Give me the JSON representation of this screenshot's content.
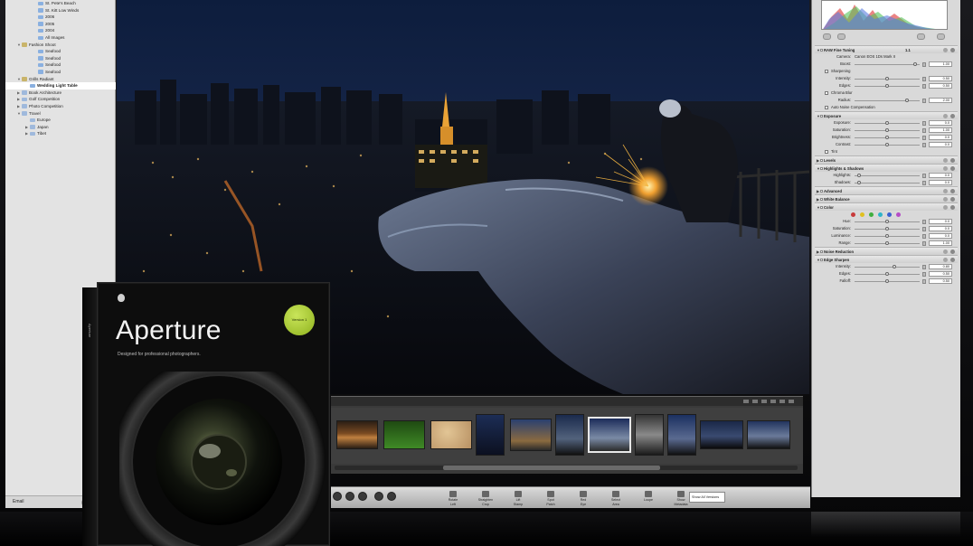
{
  "library": {
    "items": [
      {
        "label": "St. Pete's Beach",
        "indent": 3,
        "icon": "album",
        "twisty": ""
      },
      {
        "label": "St. Kitt Low Winds",
        "indent": 3,
        "icon": "album",
        "twisty": ""
      },
      {
        "label": "2006",
        "indent": 3,
        "icon": "album",
        "twisty": ""
      },
      {
        "label": "2005",
        "indent": 3,
        "icon": "album",
        "twisty": ""
      },
      {
        "label": "2004",
        "indent": 3,
        "icon": "album",
        "twisty": ""
      },
      {
        "label": "All Images",
        "indent": 3,
        "icon": "album",
        "twisty": ""
      },
      {
        "label": "Fashion Shoot",
        "indent": 1,
        "icon": "proj",
        "twisty": "▼"
      },
      {
        "label": "Seafood",
        "indent": 3,
        "icon": "album",
        "twisty": ""
      },
      {
        "label": "Seafood",
        "indent": 3,
        "icon": "album",
        "twisty": ""
      },
      {
        "label": "Seafood",
        "indent": 3,
        "icon": "album",
        "twisty": ""
      },
      {
        "label": "Seafood",
        "indent": 3,
        "icon": "album",
        "twisty": ""
      },
      {
        "label": "Grills Radiant",
        "indent": 1,
        "icon": "proj",
        "twisty": "▼"
      },
      {
        "label": "Wedding Light Table",
        "indent": 2,
        "icon": "album",
        "twisty": "",
        "selected": true
      },
      {
        "label": "Book Architecture",
        "indent": 1,
        "icon": "folder",
        "twisty": "▶"
      },
      {
        "label": "Golf Competition",
        "indent": 1,
        "icon": "folder",
        "twisty": "▶"
      },
      {
        "label": "Photo Competition",
        "indent": 1,
        "icon": "folder",
        "twisty": "▶"
      },
      {
        "label": "Travel",
        "indent": 1,
        "icon": "folder",
        "twisty": "▼"
      },
      {
        "label": "Europe",
        "indent": 2,
        "icon": "folder",
        "twisty": ""
      },
      {
        "label": "Japan",
        "indent": 2,
        "icon": "folder",
        "twisty": "▶"
      },
      {
        "label": "Tibet",
        "indent": 2,
        "icon": "folder",
        "twisty": "▶"
      }
    ],
    "filter_label": "Email"
  },
  "adjustments": {
    "rows": [
      {
        "kind": "head",
        "label": "RAW Fine Tuning",
        "value": "1.1",
        "open": true
      },
      {
        "kind": "text",
        "label": "Camera:",
        "text": "Canon EOS 1Ds Mark II"
      },
      {
        "kind": "param",
        "label": "Boost:",
        "value": "1.00",
        "pos": 0.96
      },
      {
        "kind": "check",
        "label": "Sharpening"
      },
      {
        "kind": "param",
        "label": "Intensity:",
        "value": "0.50",
        "pos": 0.5
      },
      {
        "kind": "param",
        "label": "Edges:",
        "value": "0.50",
        "pos": 0.5
      },
      {
        "kind": "check",
        "label": "Chroma Blur"
      },
      {
        "kind": "param",
        "label": "Radius:",
        "value": "2.00",
        "pos": 0.82
      },
      {
        "kind": "check",
        "label": "Auto Noise Compensation"
      },
      {
        "kind": "head",
        "label": "Exposure",
        "open": true
      },
      {
        "kind": "param",
        "label": "Exposure:",
        "value": "0.0",
        "pos": 0.5
      },
      {
        "kind": "param",
        "label": "Saturation:",
        "value": "1.00",
        "pos": 0.5
      },
      {
        "kind": "param",
        "label": "Brightness:",
        "value": "0.0",
        "pos": 0.5
      },
      {
        "kind": "param",
        "label": "Contrast:",
        "value": "0.0",
        "pos": 0.5
      },
      {
        "kind": "check",
        "label": "Tint"
      },
      {
        "kind": "head",
        "label": "Levels",
        "open": false
      },
      {
        "kind": "head",
        "label": "Highlights & Shadows",
        "open": true
      },
      {
        "kind": "param",
        "label": "Highlights:",
        "value": "0.0",
        "pos": 0.05
      },
      {
        "kind": "param",
        "label": "Shadows:",
        "value": "0.0",
        "pos": 0.05
      },
      {
        "kind": "head",
        "label": "Advanced",
        "open": false
      },
      {
        "kind": "head",
        "label": "White Balance",
        "open": false
      },
      {
        "kind": "head",
        "label": "Color",
        "open": true
      },
      {
        "kind": "swatches"
      },
      {
        "kind": "param",
        "label": "Hue:",
        "value": "0.0",
        "pos": 0.5
      },
      {
        "kind": "param",
        "label": "Saturation:",
        "value": "0.0",
        "pos": 0.5
      },
      {
        "kind": "param",
        "label": "Luminance:",
        "value": "0.0",
        "pos": 0.5
      },
      {
        "kind": "param",
        "label": "Range:",
        "value": "1.00",
        "pos": 0.5
      },
      {
        "kind": "head",
        "label": "Noise Reduction",
        "open": false
      },
      {
        "kind": "head",
        "label": "Edge Sharpen",
        "open": true
      },
      {
        "kind": "param",
        "label": "Intensity:",
        "value": "0.80",
        "pos": 0.62
      },
      {
        "kind": "param",
        "label": "Edges:",
        "value": "0.50",
        "pos": 0.5
      },
      {
        "kind": "param",
        "label": "Falloff:",
        "value": "0.50",
        "pos": 0.5
      }
    ],
    "swatch_colors": [
      "#c83a3a",
      "#e0c020",
      "#3fae3f",
      "#2fb3c9",
      "#3b5fd0",
      "#b54cc7"
    ]
  },
  "toolbar": {
    "buttons": [
      {
        "label": "Rotate",
        "sub": "Left"
      },
      {
        "label": "Straighten",
        "sub": "Crop"
      },
      {
        "label": "Lift",
        "sub": "Stamp"
      },
      {
        "label": "Spot",
        "sub": "Patch"
      },
      {
        "label": "Red",
        "sub": "Eye"
      },
      {
        "label": "Select",
        "sub": "Area"
      },
      {
        "label": "Loupe",
        "sub": ""
      },
      {
        "label": "Show",
        "sub": "Metadata"
      }
    ],
    "search_value": "Show All Versions"
  },
  "box": {
    "title": "Aperture",
    "tagline": "Designed for professional photographers.",
    "side_text": "Aperture",
    "badge": "Version 1"
  },
  "colors": {
    "panel": "#d9d9d9",
    "selection": "#ffffff",
    "film": "#3f3f3f"
  }
}
